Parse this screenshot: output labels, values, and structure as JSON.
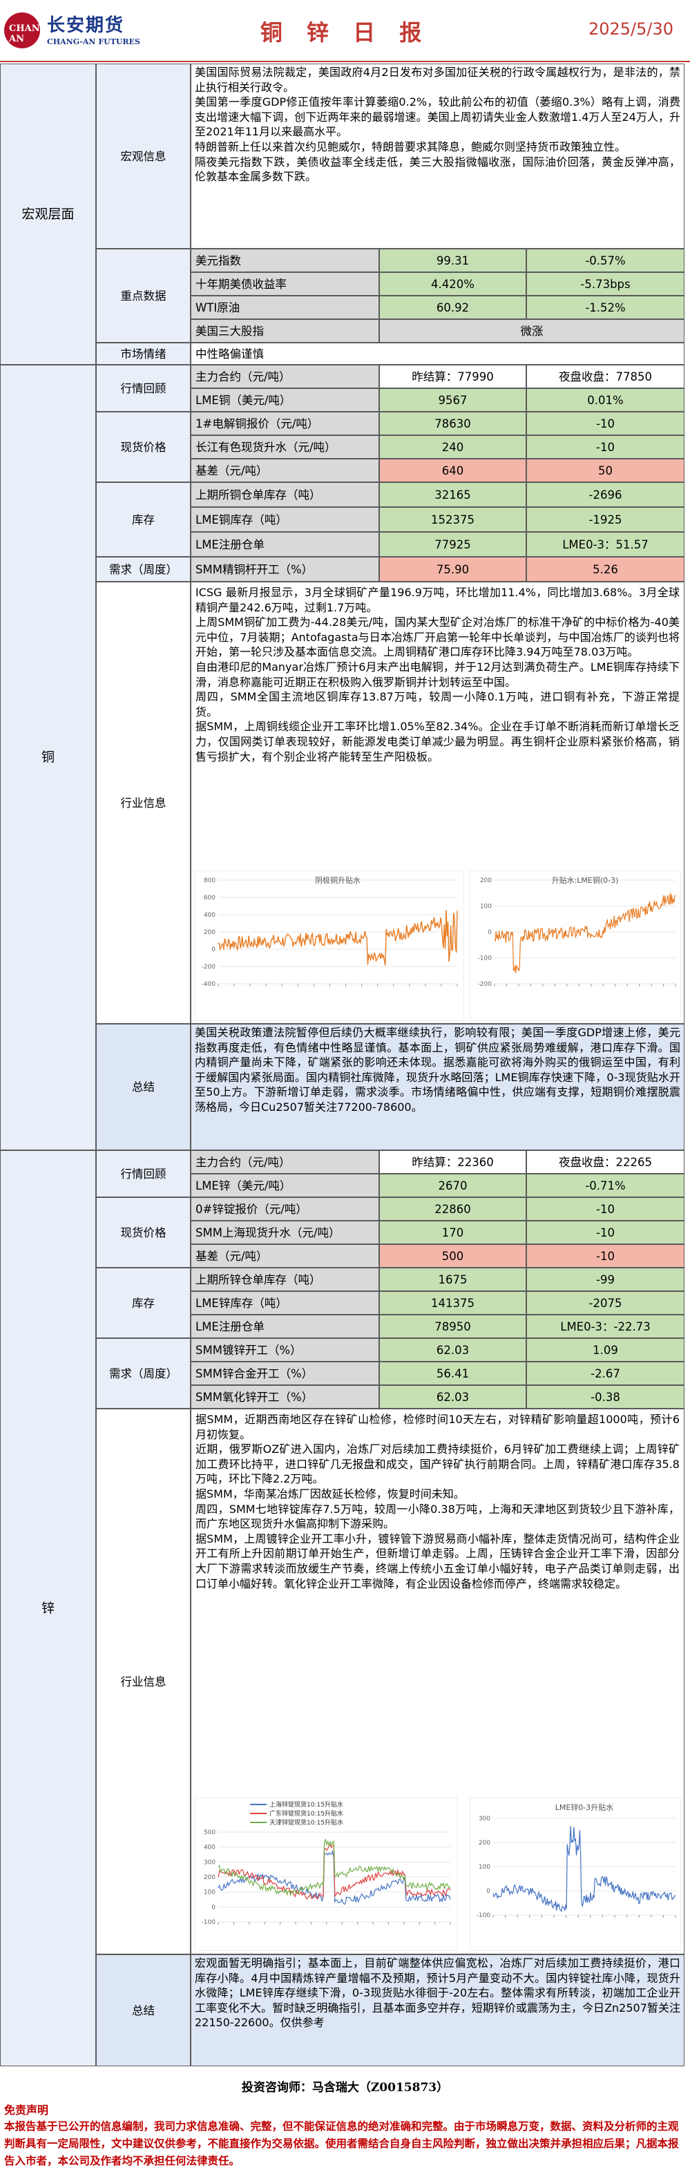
{
  "header": {
    "logo_mark": "CHANG-AN",
    "logo_cn": "长安期货",
    "logo_en": "CHANG-AN FUTURES",
    "title": "铜 锌 日 报",
    "date": "2025/5/30"
  },
  "macro": {
    "section": "宏观层面",
    "info_label": "宏观信息",
    "info_text": "美国国际贸易法院裁定，美国政府4月2日发布对多国加征关税的行政令属越权行为，是非法的，禁止执行相关行政令。\n美国第一季度GDP修正值按年率计算萎缩0.2%，较此前公布的初值（萎缩0.3%）略有上调，消费支出增速大幅下调，创下近两年来的最弱增速。美国上周初请失业金人数激增1.4万人至24万人，升至2021年11月以来最高水平。\n特朗普新上任以来首次约见鲍威尔，特朗普要求其降息，鲍威尔则坚持货币政策独立性。\n隔夜美元指数下跌，美债收益率全线走低，美三大股指微幅收涨，国际油价回落，黄金反弹冲高，伦敦基本金属多数下跌。",
    "key_label": "重点数据",
    "key_rows": [
      {
        "name": "美元指数",
        "value": "99.31",
        "change": "-0.57%"
      },
      {
        "name": "十年期美债收益率",
        "value": "4.420%",
        "change": "-5.73bps"
      },
      {
        "name": "WTI原油",
        "value": "60.92",
        "change": "-1.52%"
      },
      {
        "name": "美国三大股指",
        "value": "",
        "change": "微涨"
      }
    ],
    "mood_label": "市场情绪",
    "mood_value": "中性略偏谨慎"
  },
  "copper": {
    "section": "铜",
    "market_label": "行情回顾",
    "contract_name": "主力合约（元/吨）",
    "contract_close": "昨结算：77990",
    "contract_night": "夜盘收盘：77850",
    "lme_name": "LME铜（美元/吨）",
    "lme_value": "9567",
    "lme_change": "0.01%",
    "spot_label": "现货价格",
    "spot_rows": [
      {
        "name": "1#电解铜报价（元/吨）",
        "value": "78630",
        "change": "-10"
      },
      {
        "name": "长江有色现货升水（元/吨）",
        "value": "240",
        "change": "-10"
      },
      {
        "name": "基差（元/吨）",
        "value": "640",
        "change": "50"
      }
    ],
    "stock_label": "库存",
    "stock_rows": [
      {
        "name": "上期所铜仓单库存（吨）",
        "value": "32165",
        "change": "-2696"
      },
      {
        "name": "LME铜库存（吨）",
        "value": "152375",
        "change": "-1925"
      },
      {
        "name": "LME注册仓单",
        "value": "77925",
        "change": "LME0-3：51.57"
      }
    ],
    "demand_label": "需求（周度）",
    "demand_row": {
      "name": "SMM精铜杆开工（%）",
      "value": "75.90",
      "change": "5.26"
    },
    "industry_label": "行业信息",
    "industry_text": "ICSG 最新月报显示，3月全球铜矿产量196.9万吨，环比增加11.4%，同比增加3.68%。3月全球精铜产量242.6万吨，过剩1.7万吨。\n上周SMM铜矿加工费为-44.28美元/吨，国内某大型矿企对冶炼厂的标准干净矿的中标价格为-40美元中位，7月装期；Antofagasta与日本冶炼厂开启第一轮年中长单谈判，与中国冶炼厂的谈判也将开始，第一轮只涉及基本面信息交流。上周铜精矿港口库存环比降3.94万吨至78.03万吨。\n自由港印尼的Manyar冶炼厂预计6月末产出电解铜，并于12月达到满负荷生产。LME铜库存持续下滑，消息称嘉能可近期正在积极购入俄罗斯铜并计划转运至中国。\n周四，SMM全国主流地区铜库存13.87万吨，较周一小降0.1万吨，进口铜有补充，下游正常提货。\n据SMM，上周铜线缆企业开工率环比增1.05%至82.34%。企业在手订单不断消耗而新订单增长乏力，仅国网类订单表现较好，新能源发电类订单减少最为明显。再生铜杆企业原料紧张价格高，销售亏损扩大，有个别企业将产能转至生产阳极板。",
    "chart_left": {
      "title": "阴极铜升贴水"
    },
    "chart_right": {
      "title": "升贴水:LME铜(0-3)"
    },
    "summary_label": "总结",
    "summary_text": "美国关税政策遭法院暂停但后续仍大概率继续执行，影响较有限；美国一季度GDP增速上修，美元指数再度走低，有色情绪中性略显谨慎。基本面上，铜矿供应紧张局势难缓解，港口库存下滑。国内精铜产量尚未下降，矿端紧张的影响还未体现。据悉嘉能可欲将海外购买的俄铜运至中国，有利于缓解国内紧张局面。国内精铜社库微降，现货升水略回落；LME铜库存快速下降，0-3现货贴水开至50上方。下游新增订单走弱，需求淡季。市场情绪略偏中性，供应端有支撑，短期铜价难摆脱震荡格局，今日Cu2507暂关注77200-78600。"
  },
  "zinc": {
    "section": "锌",
    "market_label": "行情回顾",
    "contract_name": "主力合约（元/吨）",
    "contract_close": "昨结算：22360",
    "contract_night": "夜盘收盘：22265",
    "lme_name": "LME锌（美元/吨）",
    "lme_value": "2670",
    "lme_change": "-0.71%",
    "spot_label": "现货价格",
    "spot_rows": [
      {
        "name": "0#锌锭报价（元/吨）",
        "value": "22860",
        "change": "-10"
      },
      {
        "name": "SMM上海现货升水（元/吨）",
        "value": "170",
        "change": "-10"
      },
      {
        "name": "基差（元/吨）",
        "value": "500",
        "change": "-10"
      }
    ],
    "stock_label": "库存",
    "stock_rows": [
      {
        "name": "上期所锌仓单库存（吨）",
        "value": "1675",
        "change": "-99"
      },
      {
        "name": "LME锌库存（吨）",
        "value": "141375",
        "change": "-2075"
      },
      {
        "name": "LME注册仓单",
        "value": "78950",
        "change": "LME0-3：-22.73"
      }
    ],
    "demand_label": "需求（周度）",
    "demand_rows": [
      {
        "name": "SMM镀锌开工（%）",
        "value": "62.03",
        "change": "1.09"
      },
      {
        "name": "SMM锌合金开工（%）",
        "value": "56.41",
        "change": "-2.67"
      },
      {
        "name": "SMM氧化锌开工（%）",
        "value": "62.03",
        "change": "-0.38"
      }
    ],
    "industry_label": "行业信息",
    "industry_text": "据SMM，近期西南地区存在锌矿山检修，检修时间10天左右，对锌精矿影响量超1000吨，预计6月初恢复。\n近期，俄罗斯OZ矿进入国内，冶炼厂对后续加工费持续挺价，6月锌矿加工费继续上调；上周锌矿加工费环比持平，进口锌矿几无报盘和成交，国产锌矿执行前期合同。上周，锌精矿港口库存35.8万吨，环比下降2.2万吨。\n据SMM，华南某冶炼厂因故延长检修，恢复时间未知。\n周四，SMM七地锌锭库存7.5万吨，较周一小降0.38万吨，上海和天津地区到货较少且下游补库，而广东地区现货升水偏高抑制下游采购。\n据SMM，上周镀锌企业开工率小升，镀锌管下游贸易商小幅补库，整体走货情况尚可，结构件企业开工有所上升因前期订单开始生产，但新增订单走弱。上周，压铸锌合金企业开工率下滑，因部分大厂下游需求转淡而放缓生产节奏，终端上传统小五金订单小幅好转，电子产品类订单则走弱，出口订单小幅好转。氧化锌企业开工率微降，有企业因设备检修而停产，终端需求较稳定。",
    "chart_left": {
      "legend": [
        "上海锌锭现货10:15升贴水",
        "广东锌锭现货10:15升贴水",
        "天津锌锭现货10:15升贴水"
      ]
    },
    "chart_right": {
      "title": "LME锌0-3升贴水"
    },
    "summary_label": "总结",
    "summary_text": "宏观面暂无明确指引；基本面上，目前矿端整体供应偏宽松，冶炼厂对后续加工费持续挺价，港口库存小降。4月中国精炼锌产量增幅不及预期，预计5月产量变动不大。国内锌锭社库小降，现货升水微降；LME锌库存继续下滑，0-3现货贴水徘徊于-20左右。整体需求有所转淡，初端加工企业开工率变化不大。暂时缺乏明确指引，且基本面多空并存，短期锌价或震荡为主，今日Zn2507暂关注22150-22600。仅供参考"
  },
  "footer": {
    "analyst": "投资咨询师：马含瑞大（Z0015873）",
    "disclaimer_title": "免责声明",
    "disclaimer_text": "本报告基于已公开的信息编制，我司力求信息准确、完整，但不能保证信息的绝对准确和完整。由于市场瞬息万变，数据、资料及分析师的主观判断具有一定局限性，文中建议仅供参考，不能直接作为交易依据。使用者需结合自身自主风险判断，独立做出决策并承担相应后果；凡据本报告入市者，本公司及作者均不承担任何法律责任。"
  },
  "palette": {
    "header_red": "#c23a32",
    "logo_blue": "#1d3a8a",
    "label_bg": "#e9eff8",
    "green": "#c6e0b4",
    "grey": "#d9d9d9",
    "pink": "#f4b6a9",
    "line_orange": "#e87b22",
    "disclaimer_red": "#c00000"
  }
}
